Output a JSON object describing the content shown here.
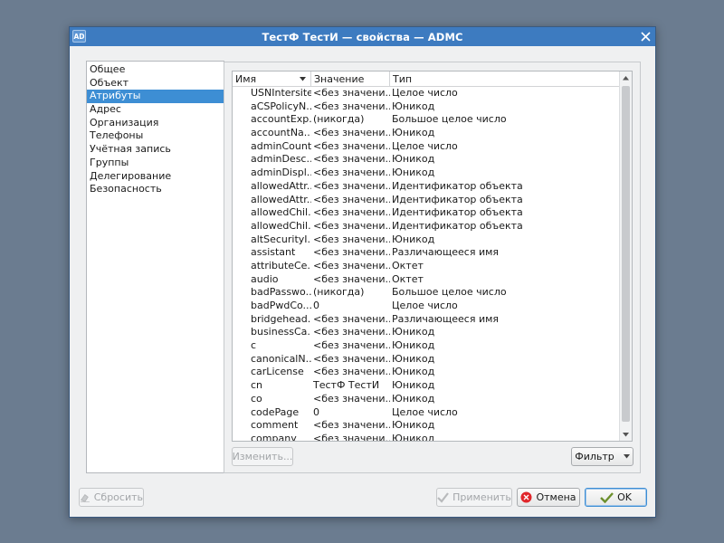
{
  "window": {
    "title": "ТестФ ТестИ — свойства — ADMC",
    "app_icon_label": "AD"
  },
  "nav": {
    "items": [
      {
        "label": "Общее"
      },
      {
        "label": "Объект"
      },
      {
        "label": "Атрибуты",
        "selected": true
      },
      {
        "label": "Адрес"
      },
      {
        "label": "Организация"
      },
      {
        "label": "Телефоны"
      },
      {
        "label": "Учётная запись"
      },
      {
        "label": "Группы"
      },
      {
        "label": "Делегирование"
      },
      {
        "label": "Безопасность"
      }
    ]
  },
  "attributes": {
    "columns": {
      "name": "Имя",
      "value": "Значение",
      "type": "Тип"
    },
    "rows": [
      {
        "name": "USNIntersite",
        "value": "<без значени...",
        "type": "Целое число"
      },
      {
        "name": "aCSPolicyN...",
        "value": "<без значени...",
        "type": "Юникод"
      },
      {
        "name": "accountExp...",
        "value": "(никогда)",
        "type": "Большое целое число"
      },
      {
        "name": "accountNa...",
        "value": "<без значени...",
        "type": "Юникод"
      },
      {
        "name": "adminCount",
        "value": "<без значени...",
        "type": "Целое число"
      },
      {
        "name": "adminDesc...",
        "value": "<без значени...",
        "type": "Юникод"
      },
      {
        "name": "adminDispl...",
        "value": "<без значени...",
        "type": "Юникод"
      },
      {
        "name": "allowedAttr...",
        "value": "<без значени...",
        "type": "Идентификатор объекта"
      },
      {
        "name": "allowedAttr...",
        "value": "<без значени...",
        "type": "Идентификатор объекта"
      },
      {
        "name": "allowedChil...",
        "value": "<без значени...",
        "type": "Идентификатор объекта"
      },
      {
        "name": "allowedChil...",
        "value": "<без значени...",
        "type": "Идентификатор объекта"
      },
      {
        "name": "altSecurityI...",
        "value": "<без значени...",
        "type": "Юникод"
      },
      {
        "name": "assistant",
        "value": "<без значени...",
        "type": "Различающееся имя"
      },
      {
        "name": "attributeCe...",
        "value": "<без значени...",
        "type": "Октет"
      },
      {
        "name": "audio",
        "value": "<без значени...",
        "type": "Октет"
      },
      {
        "name": "badPasswo...",
        "value": "(никогда)",
        "type": "Большое целое число"
      },
      {
        "name": "badPwdCo...",
        "value": "0",
        "type": "Целое число"
      },
      {
        "name": "bridgehead...",
        "value": "<без значени...",
        "type": "Различающееся имя"
      },
      {
        "name": "businessCa...",
        "value": "<без значени...",
        "type": "Юникод"
      },
      {
        "name": "c",
        "value": "<без значени...",
        "type": "Юникод"
      },
      {
        "name": "canonicalN...",
        "value": "<без значени...",
        "type": "Юникод"
      },
      {
        "name": "carLicense",
        "value": "<без значени...",
        "type": "Юникод"
      },
      {
        "name": "cn",
        "value": "ТестФ ТестИ",
        "type": "Юникод"
      },
      {
        "name": "co",
        "value": "<без значени...",
        "type": "Юникод"
      },
      {
        "name": "codePage",
        "value": "0",
        "type": "Целое число"
      },
      {
        "name": "comment",
        "value": "<без значени...",
        "type": "Юникод"
      },
      {
        "name": "company",
        "value": "<без значени...",
        "type": "Юникод"
      }
    ]
  },
  "buttons": {
    "edit": "Изменить...",
    "filter": "Фильтр",
    "reset": "Сбросить",
    "apply": "Применить",
    "cancel": "Отмена",
    "ok": "OK"
  },
  "colors": {
    "titlebar": "#3d7bc0",
    "selection": "#3d8ed4",
    "background": "#6b7c90"
  }
}
